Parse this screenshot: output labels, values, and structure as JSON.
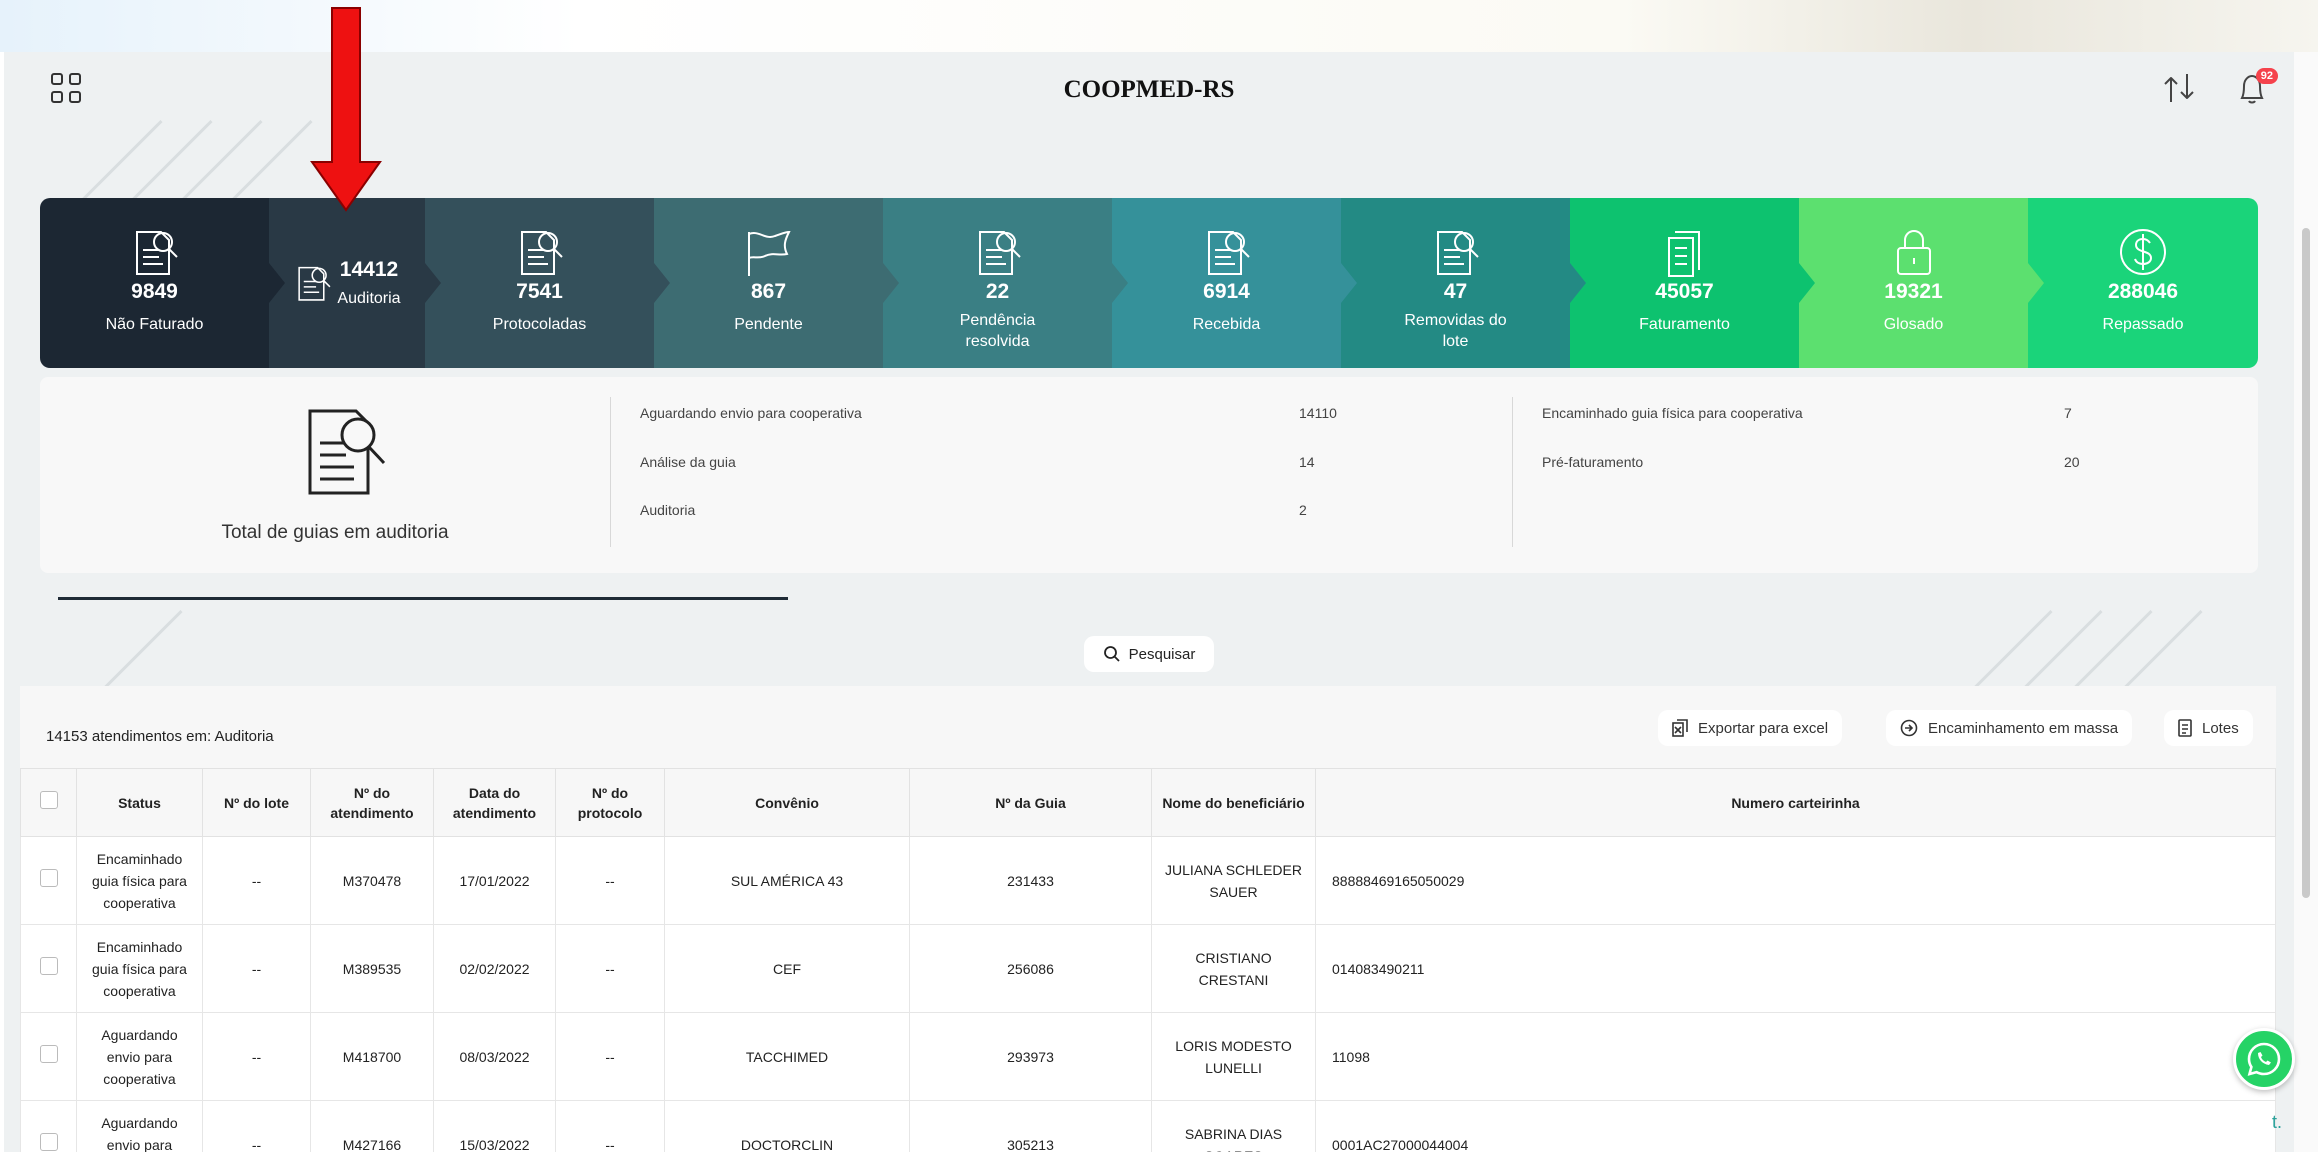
{
  "header": {
    "title": "COOPMED-RS",
    "notifications": "92"
  },
  "steps": [
    {
      "id": "nao-faturado",
      "count": "9849",
      "label": "Não Faturado",
      "color": "#1c2733",
      "icon": "search-document-icon",
      "width": 229
    },
    {
      "id": "auditoria",
      "count": "14412",
      "label": "Auditoria",
      "color": "#293945",
      "icon": "search-document-icon",
      "width": 156
    },
    {
      "id": "protocoladas",
      "count": "7541",
      "label": "Protocoladas",
      "color": "#34505b",
      "icon": "search-document-icon",
      "width": 229
    },
    {
      "id": "pendente",
      "count": "867",
      "label": "Pendente",
      "color": "#3d6c72",
      "icon": "flag-icon",
      "width": 229
    },
    {
      "id": "pendencia-resolvida",
      "count": "22",
      "label": "Pendência resolvida",
      "color": "#3a7f84",
      "icon": "search-document-icon",
      "width": 229
    },
    {
      "id": "recebida",
      "count": "6914",
      "label": "Recebida",
      "color": "#35919a",
      "icon": "search-document-icon",
      "width": 229
    },
    {
      "id": "removidas-do-lote",
      "count": "47",
      "label": "Removidas do lote",
      "color": "#238a84",
      "icon": "search-document-icon",
      "width": 229
    },
    {
      "id": "faturamento",
      "count": "45057",
      "label": "Faturamento",
      "color": "#0dc26f",
      "icon": "documents-icon",
      "width": 229
    },
    {
      "id": "glosado",
      "count": "19321",
      "label": "Glosado",
      "color": "#5ce06f",
      "icon": "lock-icon",
      "width": 229
    },
    {
      "id": "repassado",
      "count": "288046",
      "label": "Repassado",
      "color": "#1ad47a",
      "icon": "dollar-icon",
      "width": 230
    }
  ],
  "summary": {
    "caption": "Total de guias em auditoria",
    "left": [
      {
        "label": "Aguardando envio para cooperativa",
        "value": "14110"
      },
      {
        "label": "Análise da guia",
        "value": "14"
      },
      {
        "label": "Auditoria",
        "value": "2"
      }
    ],
    "right": [
      {
        "label": "Encaminhado guia física para cooperativa",
        "value": "7"
      },
      {
        "label": "Pré-faturamento",
        "value": "20"
      }
    ]
  },
  "search": {
    "label": "Pesquisar"
  },
  "panel": {
    "count_text": "14153 atendimentos em: Auditoria",
    "export_label": "Exportar para excel",
    "mass_label": "Encaminhamento em massa",
    "lotes_label": "Lotes"
  },
  "table": {
    "headers": [
      "Status",
      "Nº do lote",
      "Nº do atendimento",
      "Data do atendimento",
      "Nº do protocolo",
      "Convênio",
      "Nº da Guia",
      "Nome do beneficiário",
      "Numero carteirinha"
    ],
    "rows": [
      [
        "Encaminhado guia física para cooperativa",
        "--",
        "M370478",
        "17/01/2022",
        "--",
        "SUL AMÉRICA 43",
        "231433",
        "JULIANA SCHLEDER SAUER",
        "88888469165050029"
      ],
      [
        "Encaminhado guia física para cooperativa",
        "--",
        "M389535",
        "02/02/2022",
        "--",
        "CEF",
        "256086",
        "CRISTIANO CRESTANI",
        "014083490211"
      ],
      [
        "Aguardando envio para cooperativa",
        "--",
        "M418700",
        "08/03/2022",
        "--",
        "TACCHIMED",
        "293973",
        "LORIS MODESTO LUNELLI",
        "11098"
      ],
      [
        "Aguardando envio para cooperativa",
        "--",
        "M427166",
        "15/03/2022",
        "--",
        "DOCTORCLIN",
        "305213",
        "SABRINA DIAS SOARES",
        "0001AC27000044004"
      ]
    ]
  },
  "corner_text": "t."
}
